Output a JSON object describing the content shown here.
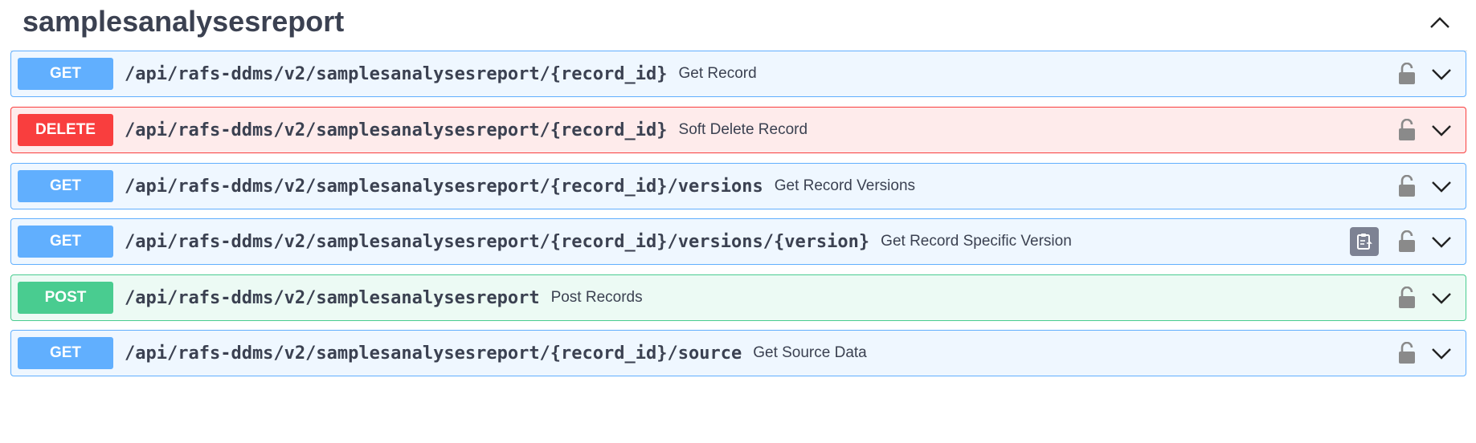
{
  "tag": {
    "title": "samplesanalysesreport",
    "toggle_icon": "chevron-up-icon"
  },
  "operations": [
    {
      "method": "GET",
      "path": "/api/rafs-ddms/v2/samplesanalysesreport/{record_id}",
      "summary": "Get Record",
      "copy_button": false
    },
    {
      "method": "DELETE",
      "path": "/api/rafs-ddms/v2/samplesanalysesreport/{record_id}",
      "summary": "Soft Delete Record",
      "copy_button": false
    },
    {
      "method": "GET",
      "path": "/api/rafs-ddms/v2/samplesanalysesreport/{record_id}/versions",
      "summary": "Get Record Versions",
      "copy_button": false
    },
    {
      "method": "GET",
      "path": "/api/rafs-ddms/v2/samplesanalysesreport/{record_id}/versions/{version}",
      "summary": "Get Record Specific Version",
      "copy_button": true
    },
    {
      "method": "POST",
      "path": "/api/rafs-ddms/v2/samplesanalysesreport",
      "summary": "Post Records",
      "copy_button": false
    },
    {
      "method": "GET",
      "path": "/api/rafs-ddms/v2/samplesanalysesreport/{record_id}/source",
      "summary": "Get Source Data",
      "copy_button": false
    }
  ],
  "colors": {
    "get": "#61affe",
    "delete": "#f93e3e",
    "post": "#49cc90",
    "text": "#3b4151",
    "icon": "#8a8a8a"
  },
  "icons": {
    "lock": "lock-icon",
    "expand": "chevron-down-icon",
    "copy": "clipboard-copy-icon"
  }
}
